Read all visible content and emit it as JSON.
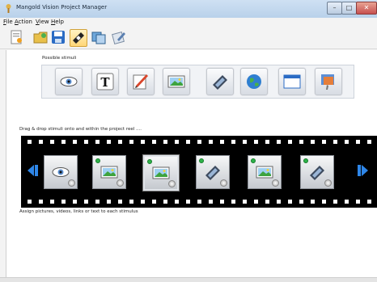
{
  "window": {
    "title": "Mangold Vision Project Manager"
  },
  "menu": [
    "File",
    "Action",
    "View",
    "Help"
  ],
  "menu_underline": [
    "F",
    "A",
    "V",
    "H"
  ],
  "menu_rest": [
    "ile",
    "ction",
    "iew",
    "elp"
  ],
  "toolbar": {
    "icons": [
      "new-project-icon",
      "open-project-icon",
      "save-icon",
      "reel-icon",
      "copy-icon",
      "settings-icon"
    ],
    "active_index": 3
  },
  "labels": {
    "possible_stimuli": "Possible stimuli",
    "drag_drop": "Drag & drop stimuli onto and within the project reel ....",
    "assign": "Assign pictures, videos, links or text to each stimulus"
  },
  "stimuli_palette": [
    "eye-icon",
    "text-icon",
    "drawing-icon",
    "picture-icon",
    "video-icon",
    "globe-icon",
    "window-icon",
    "presentation-icon"
  ],
  "reel_frames": [
    {
      "icon": "eye-icon",
      "has_dot": false,
      "selected": false
    },
    {
      "icon": "picture-icon",
      "has_dot": true,
      "selected": false
    },
    {
      "icon": "picture-icon",
      "has_dot": true,
      "selected": true
    },
    {
      "icon": "video-icon",
      "has_dot": true,
      "selected": false
    },
    {
      "icon": "picture-icon",
      "has_dot": true,
      "selected": false
    },
    {
      "icon": "video-icon",
      "has_dot": true,
      "selected": false
    }
  ],
  "colors": {
    "accent": "#1e73d6",
    "reel": "#000000",
    "dot": "#2fb34a"
  }
}
